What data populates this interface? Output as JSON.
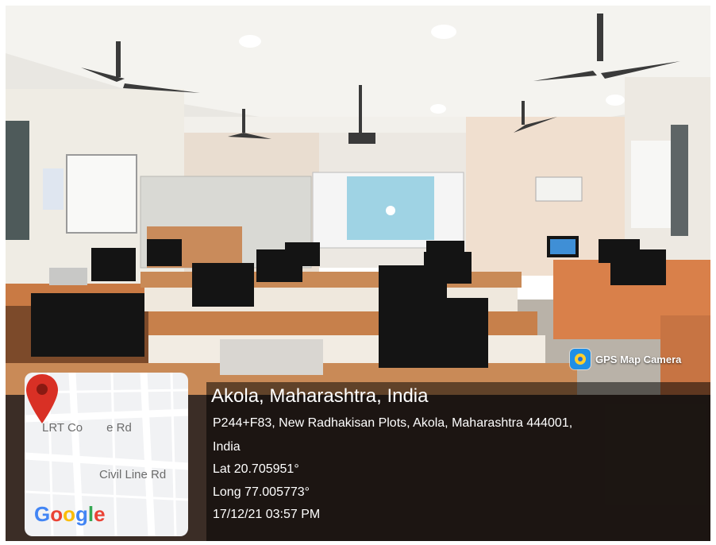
{
  "badge": {
    "label": "GPS Map Camera",
    "icon": "gps-map-camera-icon"
  },
  "location": {
    "title": "Akola, Maharashtra, India",
    "address": "P244+F83, New Radhakisan Plots, Akola, Maharashtra 444001,",
    "country": "India",
    "lat": "Lat 20.705951°",
    "long": "Long 77.005773°",
    "datetime": "17/12/21 03:57 PM"
  },
  "map": {
    "road_top": "LRT Co",
    "road_top_suffix": "e Rd",
    "road_bottom": "Civil Line Rd",
    "logo_letters": [
      {
        "ch": "G",
        "color": "#4285F4"
      },
      {
        "ch": "o",
        "color": "#EA4335"
      },
      {
        "ch": "o",
        "color": "#FBBC05"
      },
      {
        "ch": "g",
        "color": "#4285F4"
      },
      {
        "ch": "l",
        "color": "#34A853"
      },
      {
        "ch": "e",
        "color": "#EA4335"
      }
    ],
    "pin_color": "#d93025"
  }
}
